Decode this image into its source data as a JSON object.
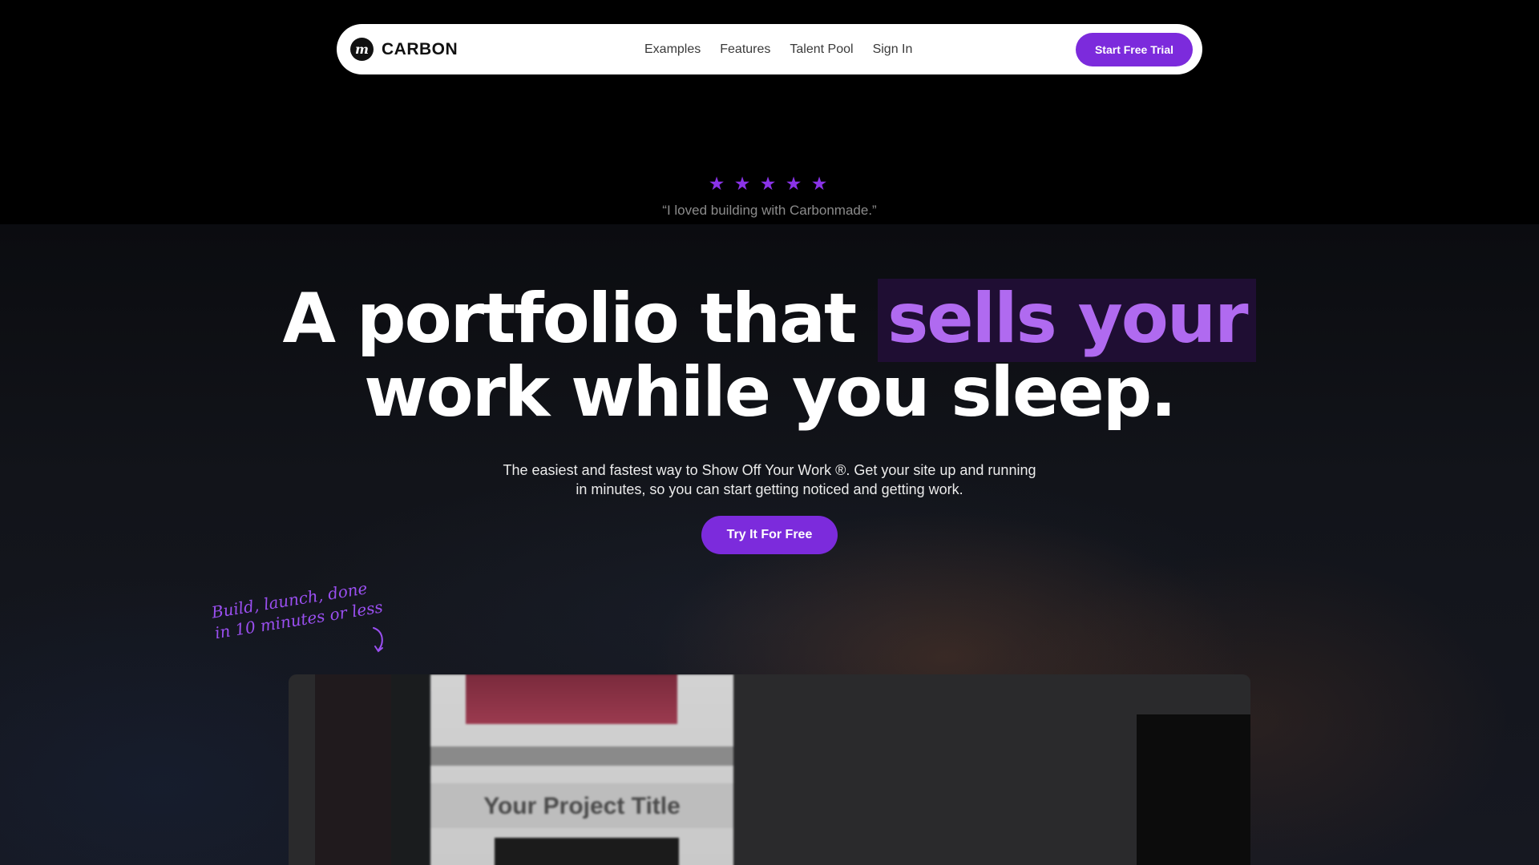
{
  "nav": {
    "logo_word": "CARBON",
    "links": [
      "Examples",
      "Features",
      "Talent Pool",
      "Sign In"
    ],
    "cta": "Start Free Trial"
  },
  "rating": {
    "stars": 5,
    "quote": "“I loved building with Carbonmade.”"
  },
  "hero": {
    "headline_part1": "A portfolio that",
    "headline_highlight": "sells your",
    "headline_part2": "work while you sleep.",
    "sub_line1": "The easiest and fastest way to Show Off Your Work ®. Get your site up and running",
    "sub_line2": "in minutes, so you can start getting noticed and getting work.",
    "cta": "Try It For Free"
  },
  "note": {
    "line1": "Build, launch, done",
    "line2": "in 10 minutes or less"
  },
  "preview": {
    "project_title": "Your Project Title"
  },
  "colors": {
    "accent": "#7c2bdc",
    "highlight_text": "#b06af0",
    "highlight_bg": "#1f0e33",
    "background": "#000000"
  }
}
